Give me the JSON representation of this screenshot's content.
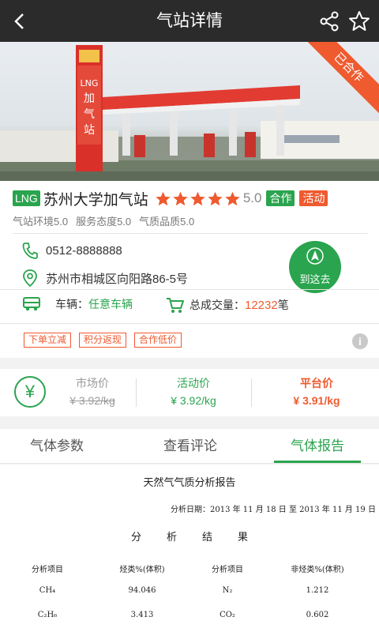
{
  "header": {
    "title": "气站详情",
    "icons": [
      "back-icon",
      "share-icon",
      "star-icon"
    ]
  },
  "hero": {
    "ribbon": "已合作"
  },
  "station": {
    "type_tag": "LNG",
    "name": "苏州大学加气站",
    "stars": 5,
    "rating": "5.0",
    "badges": [
      "合作",
      "活动"
    ],
    "sub_ratings": [
      "气站环境5.0",
      "服务态度5.0",
      "气质品质5.0"
    ],
    "phone": "0512-8888888",
    "address": "苏州市相城区向阳路86-5号",
    "navigate_label": "到这去",
    "vehicle_label": "车辆：",
    "vehicle_value": "任意车辆",
    "deal_label": "总成交量：",
    "deal_count": "12232",
    "deal_unit": "笔",
    "promotions": [
      "下单立减",
      "积分返现",
      "合作低价"
    ]
  },
  "prices": {
    "currency_icon": "¥",
    "market_label": "市场价",
    "market_value": "¥ 3.92/kg",
    "activity_label": "活动价",
    "activity_value": "¥ 3.92/kg",
    "platform_label": "平台价",
    "platform_value": "¥ 3.91/kg"
  },
  "tabs": [
    "气体参数",
    "查看评论",
    "气体报告"
  ],
  "active_tab": 2,
  "report": {
    "title": "天然气气质分析报告",
    "date": "分析日期：2013 年 11 月 18 日 至 2013 年 11 月 19 日",
    "section": "分析结果",
    "headers": [
      "分析项目",
      "烃类%(体积)",
      "分析项目",
      "非烃类%(体积)"
    ],
    "rows": [
      [
        "CH₄",
        "94.046",
        "N₂",
        "1.212"
      ],
      [
        "C₂H₆",
        "3.413",
        "CO₂",
        "0.602"
      ]
    ]
  },
  "colors": {
    "accent": "#2aa44e",
    "orange": "#ef5a2f",
    "topbar": "#2b2b2b",
    "star": "#ef5a2f"
  }
}
